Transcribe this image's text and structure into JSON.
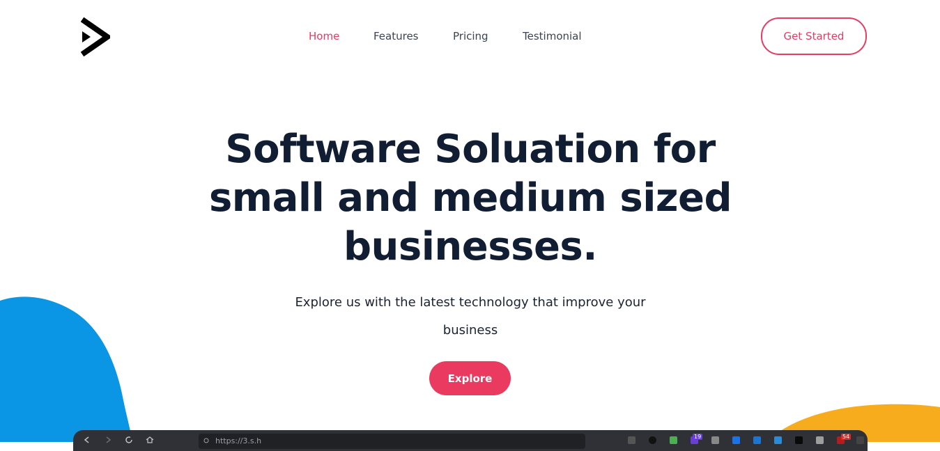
{
  "nav": {
    "links": [
      {
        "label": "Home",
        "active": true
      },
      {
        "label": "Features",
        "active": false
      },
      {
        "label": "Pricing",
        "active": false
      },
      {
        "label": "Testimonial",
        "active": false
      }
    ],
    "cta_label": "Get Started"
  },
  "hero": {
    "title": "Software Soluation for small and medium sized businesses.",
    "subtitle": "Explore us with the latest technology that improve your business",
    "button_label": "Explore"
  },
  "browser": {
    "url_text": "https://3.s.h",
    "badges": [
      "19",
      "54"
    ]
  },
  "colors": {
    "accent": "#e83a62",
    "heading": "#101d33",
    "blob_blue": "#0b96e5",
    "blob_orange": "#f7ac1d"
  }
}
